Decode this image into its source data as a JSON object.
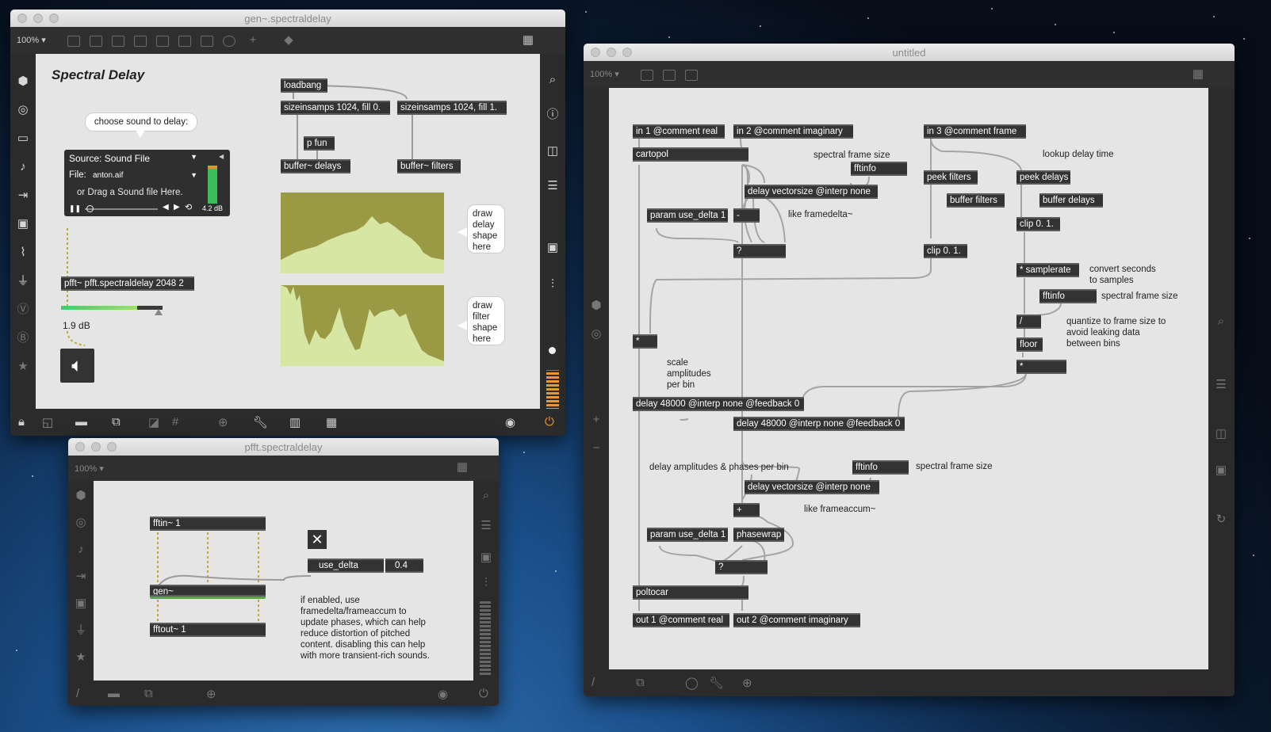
{
  "gen_window": {
    "title": "gen~.spectraldelay",
    "zoom": "100%",
    "heading": "Spectral Delay",
    "bubble_choose": "choose sound to delay:",
    "player": {
      "source": "Source: Sound File",
      "file_label": "File:",
      "file_name": "anton.aif",
      "drag_text": "or Drag a Sound file Here.",
      "level": "4.2 dB"
    },
    "objects": {
      "loadbang": "loadbang",
      "size0": "sizeinsamps 1024, fill 0.",
      "size1": "sizeinsamps 1024, fill 1.",
      "pfun": "p fun",
      "buf_delays": "buffer~ delays",
      "buf_filters": "buffer~ filters",
      "pfft": "pfft~ pfft.spectraldelay 2048 2"
    },
    "gain_value": "1.9 dB",
    "bubble_delay": "draw delay shape here",
    "bubble_filter": "draw filter shape here"
  },
  "pfft_window": {
    "title": "pfft.spectraldelay",
    "zoom": "100%",
    "objects": {
      "fftin": "fftin~ 1",
      "gen": "gen~",
      "fftout": "fftout~ 1",
      "use_delta": "use_delta",
      "number": "0.4"
    },
    "comment": "if enabled, use framedelta/frameaccum to update phases, which can help reduce distortion of pitched content. disabling this can help with more transient-rich sounds."
  },
  "untitled_window": {
    "title": "untitled",
    "zoom": "100%",
    "objects": {
      "in1": "in 1 @comment real",
      "in2": "in 2 @comment imaginary",
      "in3": "in 3 @comment frame",
      "cartopol": "cartopol",
      "fftinfo1": "fftinfo",
      "delayvec1": "delay vectorsize @interp none",
      "param1": "param use_delta 1",
      "minus": "-",
      "q1": "?",
      "peek_filters": "peek filters",
      "buffer_filters": "buffer filters",
      "peek_delays": "peek delays",
      "buffer_delays": "buffer delays",
      "clip1": "clip 0. 1.",
      "clip2": "clip 0. 1.",
      "samplerate": "* samplerate",
      "fftinfo2": "fftinfo",
      "div": "/",
      "floor": "floor",
      "mul1": "*",
      "mul2": "*",
      "delay1": "delay 48000 @interp none @feedback 0",
      "delay2": "delay 48000 @interp none @feedback 0",
      "fftinfo3": "fftinfo",
      "delayvec2": "delay vectorsize @interp none",
      "plus": "+",
      "param2": "param use_delta 1",
      "phasewrap": "phasewrap",
      "q2": "?",
      "poltocar": "poltocar",
      "out1": "out 1 @comment real",
      "out2": "out 2 @comment imaginary"
    },
    "comments": {
      "spectral1": "spectral frame size",
      "lookup": "lookup delay time",
      "like_framedelta": "like framedelta~",
      "convert1": "convert seconds",
      "convert2": "to samples",
      "spectral2": "spectral frame size",
      "quantize1": "quantize to frame size to",
      "quantize2": "avoid leaking data",
      "quantize3": "between bins",
      "scale1": "scale",
      "scale2": "amplitudes",
      "scale3": "per bin",
      "delay_amps": "delay amplitudes & phases per bin",
      "spectral3": "spectral frame size",
      "like_frameaccum": "like frameaccum~"
    }
  },
  "colors": {
    "patch_bg": "#e5e5e5",
    "object_bg": "#333333",
    "shape_fill": "#9a9a44",
    "shape_curve": "#d8e6a4",
    "gen_green": "#5aa640",
    "dsp_orange": "#e9963a"
  }
}
